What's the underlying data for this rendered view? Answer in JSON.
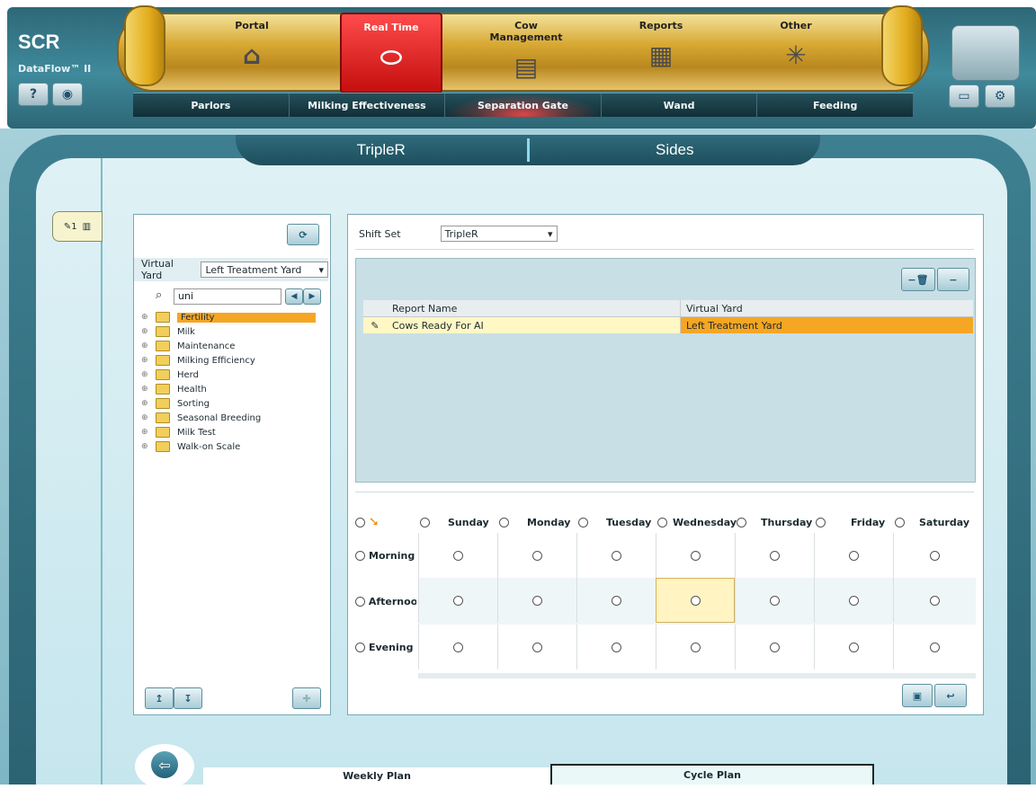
{
  "app": {
    "brand": "SCR",
    "product": "DataFlow™ II"
  },
  "top_tabs": [
    {
      "label": "Portal",
      "icon": "barn-icon"
    },
    {
      "label": "Real Time",
      "icon": "milk-tank-icon",
      "active": true
    },
    {
      "label": "Cow Management",
      "icon": "clipboard-icon"
    },
    {
      "label": "Reports",
      "icon": "reports-icon"
    },
    {
      "label": "Other",
      "icon": "box-icon"
    }
  ],
  "sub_nav": [
    {
      "label": "Parlors"
    },
    {
      "label": "Milking Effectiveness"
    },
    {
      "label": "Separation Gate",
      "active": true
    },
    {
      "label": "Wand"
    },
    {
      "label": "Feeding"
    }
  ],
  "view_tabs": {
    "left": "TripleR",
    "right": "Sides"
  },
  "side_tab": {
    "label": "1"
  },
  "left_panel": {
    "virtual_yard_label": "Virtual Yard",
    "virtual_yard_value": "Left Treatment Yard",
    "search_value": "uni",
    "tree": [
      {
        "label": "Fertility",
        "selected": true
      },
      {
        "label": "Milk"
      },
      {
        "label": "Maintenance"
      },
      {
        "label": "Milking Efficiency"
      },
      {
        "label": "Herd"
      },
      {
        "label": "Health"
      },
      {
        "label": "Sorting"
      },
      {
        "label": "Seasonal Breeding"
      },
      {
        "label": "Milk Test"
      },
      {
        "label": "Walk-on Scale"
      }
    ]
  },
  "right_panel": {
    "shift_set_label": "Shift Set",
    "shift_set_value": "TripleR",
    "grid": {
      "columns": [
        "Report Name",
        "Virtual Yard"
      ],
      "rows": [
        {
          "report_name": "Cows Ready For AI",
          "virtual_yard": "Left Treatment Yard"
        }
      ]
    },
    "schedule": {
      "days": [
        "Sunday",
        "Monday",
        "Tuesday",
        "Wednesday",
        "Thursday",
        "Friday",
        "Saturday"
      ],
      "shifts": [
        "Morning",
        "Afternoon",
        "Evening"
      ],
      "highlight": {
        "shift": "Afternoon",
        "day": "Wednesday"
      }
    }
  },
  "plans": {
    "weekly": "Weekly Plan",
    "cycle": "Cycle Plan"
  },
  "colors": {
    "accent": "#f5a623",
    "selected_row": "#fff7c4",
    "header": "#2f6b7c"
  }
}
